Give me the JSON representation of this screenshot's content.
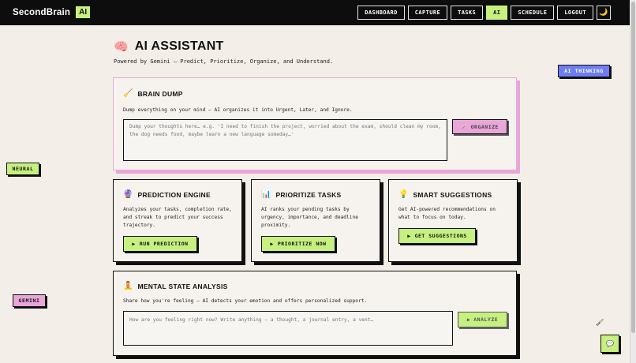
{
  "brand": {
    "name": "SecondBrain",
    "badge": "AI"
  },
  "nav": {
    "items": [
      {
        "label": "DASHBOARD"
      },
      {
        "label": "CAPTURE"
      },
      {
        "label": "TASKS"
      },
      {
        "label": "AI",
        "active": true
      },
      {
        "label": "SCHEDULE"
      },
      {
        "label": "LOGOUT"
      }
    ],
    "theme_icon": "🌙"
  },
  "header": {
    "icon": "🧠",
    "title": "AI ASSISTANT",
    "subtitle": "Powered by Gemini — Predict, Prioritize, Organize, and Understand."
  },
  "tags": {
    "thinking": "AI THINKING",
    "neural": "NEURAL",
    "gemini": "GEMINI"
  },
  "brain_dump": {
    "icon": "🧹",
    "title": "BRAIN DUMP",
    "description": "Dump everything on your mind — AI organizes it into Urgent, Later, and Ignore.",
    "placeholder": "Dump your thoughts here… e.g. 'I need to finish the project, worried about the exam, should clean my room, the dog needs food, maybe learn a new language someday…'",
    "button_icon": "🪄",
    "button_label": "ORGANIZE"
  },
  "prediction": {
    "icon": "🔮",
    "title": "PREDICTION ENGINE",
    "description": "Analyzes your tasks, completion rate, and streak to predict your success trajectory.",
    "button_label": "RUN PREDICTION"
  },
  "prioritize": {
    "icon": "📊",
    "title": "PRIORITIZE TASKS",
    "description": "AI ranks your pending tasks by urgency, importance, and deadline proximity.",
    "button_label": "PRIORITIZE NOW"
  },
  "suggestions": {
    "icon": "💡",
    "title": "SMART SUGGESTIONS",
    "description": "Get AI-powered recommendations on what to focus on today.",
    "button_label": "GET SUGGESTIONS"
  },
  "mental": {
    "icon": "🧘",
    "title": "MENTAL STATE ANALYSIS",
    "description": "Share how you're feeling — AI detects your emotion and offers personalized support.",
    "placeholder": "How are you feeling right now? Write anything — a thought, a journal entry, a vent…",
    "button_label": "ANALYZE"
  },
  "play_icon": "▶",
  "chat_icon": "💬",
  "cursor_icon": "🖌",
  "colors": {
    "accent": "#c6f07f",
    "pink": "#e9a6d9",
    "blue": "#6f7df2",
    "bg": "#f3efe8"
  }
}
